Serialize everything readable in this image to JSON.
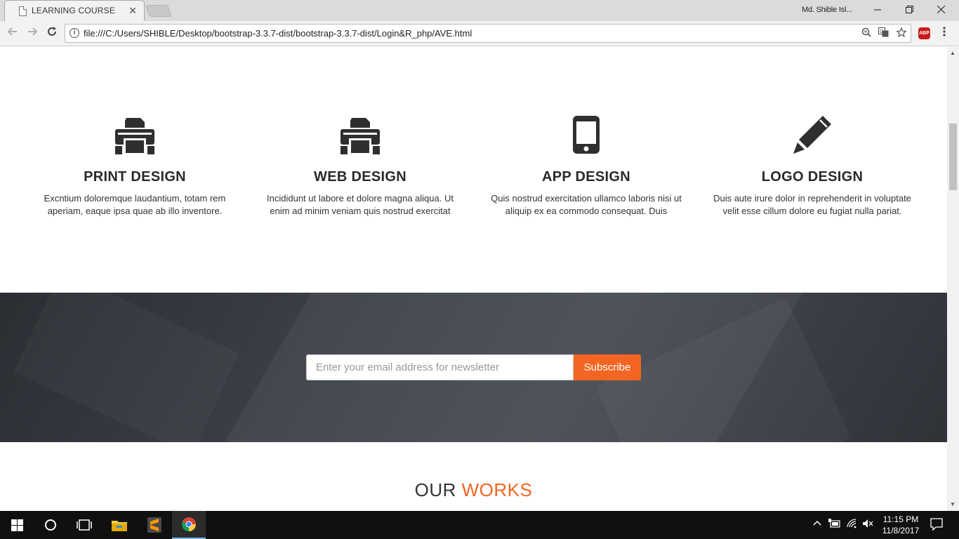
{
  "browser": {
    "tab_title": "LEARNING COURSE",
    "tab_close": "✕",
    "profile_name": "Md. Shible Isl...",
    "url": "file:///C:/Users/SHIBLE/Desktop/bootstrap-3.3.7-dist/bootstrap-3.3.7-dist/Login&R_php/AVE.html",
    "abp_label": "ABP"
  },
  "services": [
    {
      "icon": "print-icon",
      "title": "PRINT DESIGN",
      "text": "Excntium doloremque laudantium, totam rem aperiam, eaque ipsa quae ab illo inventore."
    },
    {
      "icon": "print-icon",
      "title": "WEB DESIGN",
      "text": "Incididunt ut labore et dolore magna aliqua. Ut enim ad minim veniam quis nostrud exercitat"
    },
    {
      "icon": "mobile-icon",
      "title": "APP DESIGN",
      "text": "Quis nostrud exercitation ullamco laboris nisi ut aliquip ex ea commodo consequat. Duis"
    },
    {
      "icon": "pencil-icon",
      "title": "LOGO DESIGN",
      "text": "Duis aute irure dolor in reprehenderit in voluptate velit esse cillum dolore eu fugiat nulla pariat."
    }
  ],
  "newsletter": {
    "placeholder": "Enter your email address for newsletter",
    "button_label": "Subscribe"
  },
  "works": {
    "title_main": "OUR",
    "title_accent": "WORKS"
  },
  "taskbar": {
    "time": "11:15 PM",
    "date": "11/8/2017"
  },
  "colors": {
    "accent": "#f26522",
    "dark_band": "#3c4047",
    "icon": "#2f2f2f"
  }
}
